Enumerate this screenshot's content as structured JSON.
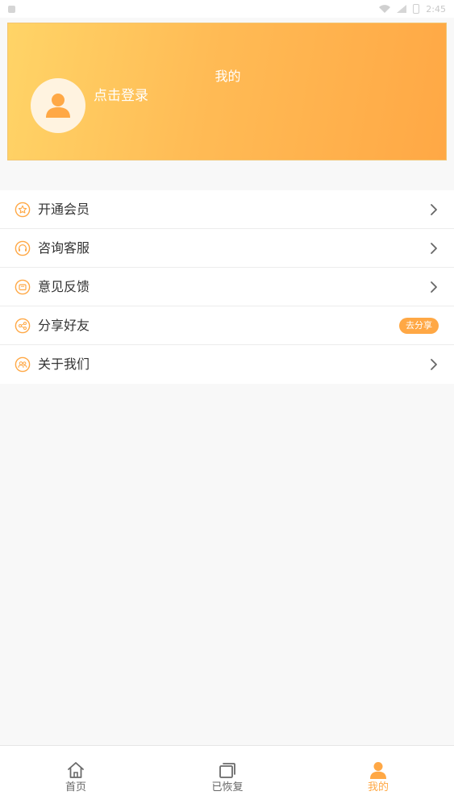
{
  "colors": {
    "accent": "#ffa845",
    "gradient_start": "#ffd467",
    "gradient_end": "#ffa845",
    "text_primary": "#333333",
    "background": "#f8f8f8"
  },
  "status_bar": {
    "time": "2:45"
  },
  "header": {
    "title": "我的",
    "login_label": "点击登录",
    "avatar_icon": "user-avatar-icon"
  },
  "menu": {
    "items": [
      {
        "label": "开通会员",
        "icon": "star-icon",
        "trailing": "chevron-right-icon"
      },
      {
        "label": "咨询客服",
        "icon": "headset-icon",
        "trailing": "chevron-right-icon"
      },
      {
        "label": "意见反馈",
        "icon": "feedback-icon",
        "trailing": "chevron-right-icon"
      },
      {
        "label": "分享好友",
        "icon": "share-icon",
        "trailing": "badge",
        "badge_label": "去分享"
      },
      {
        "label": "关于我们",
        "icon": "people-icon",
        "trailing": "chevron-right-icon"
      }
    ]
  },
  "bottom_nav": {
    "items": [
      {
        "label": "首页",
        "icon": "home-icon",
        "active": false
      },
      {
        "label": "已恢复",
        "icon": "restored-icon",
        "active": false
      },
      {
        "label": "我的",
        "icon": "profile-icon",
        "active": true
      }
    ]
  }
}
